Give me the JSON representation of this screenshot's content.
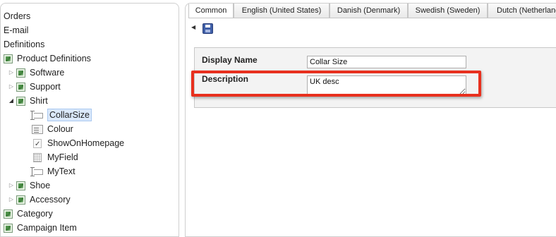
{
  "tree": {
    "items": [
      {
        "label": "Orders",
        "indent": 0
      },
      {
        "label": "E-mail",
        "indent": 0
      },
      {
        "label": "Definitions",
        "indent": 0
      },
      {
        "label": "Product Definitions",
        "indent": 0
      },
      {
        "label": "Software",
        "indent": 1
      },
      {
        "label": "Support",
        "indent": 1
      },
      {
        "label": "Shirt",
        "indent": 1
      },
      {
        "label": "CollarSize",
        "indent": 2
      },
      {
        "label": "Colour",
        "indent": 2
      },
      {
        "label": "ShowOnHomepage",
        "indent": 2
      },
      {
        "label": "MyField",
        "indent": 2
      },
      {
        "label": "MyText",
        "indent": 2
      },
      {
        "label": "Shoe",
        "indent": 1
      },
      {
        "label": "Accessory",
        "indent": 1
      },
      {
        "label": "Category",
        "indent": 0
      },
      {
        "label": "Campaign Item",
        "indent": 0
      }
    ]
  },
  "tabs": [
    "Common",
    "English (United States)",
    "Danish (Denmark)",
    "Swedish (Sweden)",
    "Dutch (Netherlands)"
  ],
  "form": {
    "display_name_label": "Display Name",
    "display_name_value": "Collar Size",
    "description_label": "Description",
    "description_value": "UK desc"
  },
  "colors": {
    "highlight": "#e8301e",
    "selection": "#dbe9fb",
    "save_icon": "#3f5fa8"
  }
}
